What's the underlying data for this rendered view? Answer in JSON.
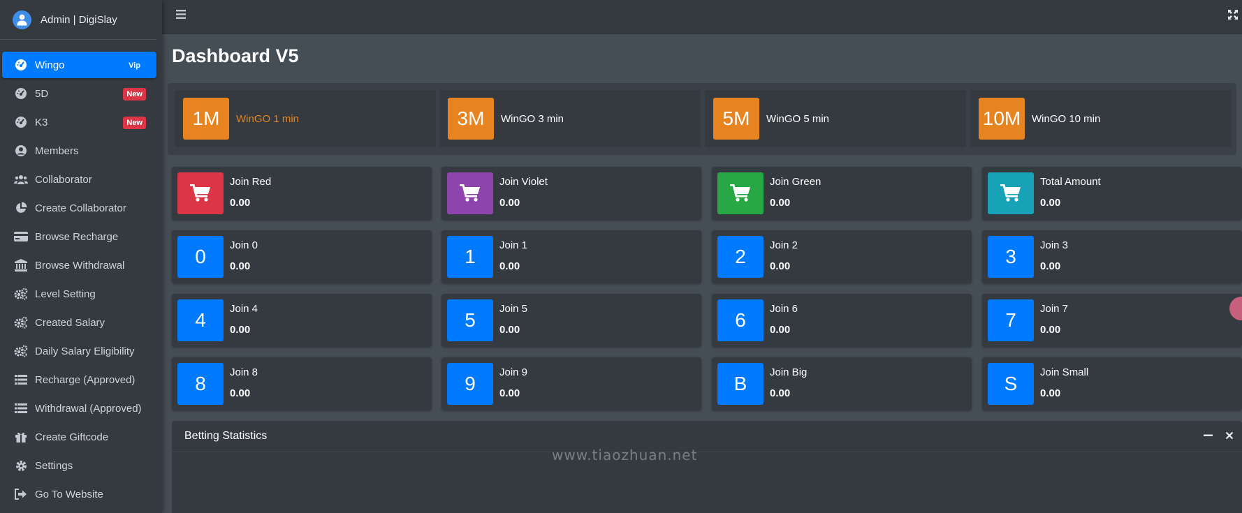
{
  "brand": {
    "title": "Admin | DigiSlay"
  },
  "sidebar": {
    "items": [
      {
        "label": "Wingo",
        "icon": "gauge-icon",
        "badge": "Vip",
        "badge_type": "vip",
        "active": true
      },
      {
        "label": "5D",
        "icon": "gauge-icon",
        "badge": "New",
        "badge_type": "new"
      },
      {
        "label": "K3",
        "icon": "gauge-icon",
        "badge": "New",
        "badge_type": "new"
      },
      {
        "label": "Members",
        "icon": "user-circle-icon"
      },
      {
        "label": "Collaborator",
        "icon": "users-icon"
      },
      {
        "label": "Create Collaborator",
        "icon": "pie-chart-icon"
      },
      {
        "label": "Browse Recharge",
        "icon": "credit-card-icon"
      },
      {
        "label": "Browse Withdrawal",
        "icon": "bank-icon"
      },
      {
        "label": "Level Setting",
        "icon": "cogs-icon"
      },
      {
        "label": "Created Salary",
        "icon": "cogs-icon"
      },
      {
        "label": "Daily Salary Eligibility",
        "icon": "cogs-icon"
      },
      {
        "label": "Recharge (Approved)",
        "icon": "list-icon"
      },
      {
        "label": "Withdrawal (Approved)",
        "icon": "list-icon"
      },
      {
        "label": "Create Giftcode",
        "icon": "gift-icon"
      },
      {
        "label": "Settings",
        "icon": "gear-icon"
      },
      {
        "label": "Go To Website",
        "icon": "sign-out-icon"
      }
    ]
  },
  "page": {
    "title": "Dashboard V5"
  },
  "games": [
    {
      "code": "1M",
      "label": "WinGO 1 min",
      "active": true
    },
    {
      "code": "3M",
      "label": "WinGO 3 min"
    },
    {
      "code": "5M",
      "label": "WinGO 5 min"
    },
    {
      "code": "10M",
      "label": "WinGO 10 min"
    }
  ],
  "stats": [
    [
      {
        "icon": "cart-icon",
        "color": "#dc3545",
        "label": "Join Red",
        "value": "0.00"
      },
      {
        "icon": "cart-icon",
        "color": "#8e44ad",
        "label": "Join Violet",
        "value": "0.00"
      },
      {
        "icon": "cart-icon",
        "color": "#28a745",
        "label": "Join Green",
        "value": "0.00"
      },
      {
        "icon": "cart-icon",
        "color": "#17a2b8",
        "label": "Total Amount",
        "value": "0.00"
      }
    ],
    [
      {
        "box": "0",
        "label": "Join 0",
        "value": "0.00"
      },
      {
        "box": "1",
        "label": "Join 1",
        "value": "0.00"
      },
      {
        "box": "2",
        "label": "Join 2",
        "value": "0.00"
      },
      {
        "box": "3",
        "label": "Join 3",
        "value": "0.00"
      }
    ],
    [
      {
        "box": "4",
        "label": "Join 4",
        "value": "0.00"
      },
      {
        "box": "5",
        "label": "Join 5",
        "value": "0.00"
      },
      {
        "box": "6",
        "label": "Join 6",
        "value": "0.00"
      },
      {
        "box": "7",
        "label": "Join 7",
        "value": "0.00"
      }
    ],
    [
      {
        "box": "8",
        "label": "Join 8",
        "value": "0.00"
      },
      {
        "box": "9",
        "label": "Join 9",
        "value": "0.00"
      },
      {
        "box": "B",
        "label": "Join Big",
        "value": "0.00"
      },
      {
        "box": "S",
        "label": "Join Small",
        "value": "0.00"
      }
    ]
  ],
  "panel": {
    "title": "Betting Statistics"
  },
  "watermark": "www.tiaozhuan.net",
  "colors": {
    "accent": "#007bff",
    "orange": "#e8841f",
    "sidebar": "#343a40",
    "content": "#454d55"
  }
}
